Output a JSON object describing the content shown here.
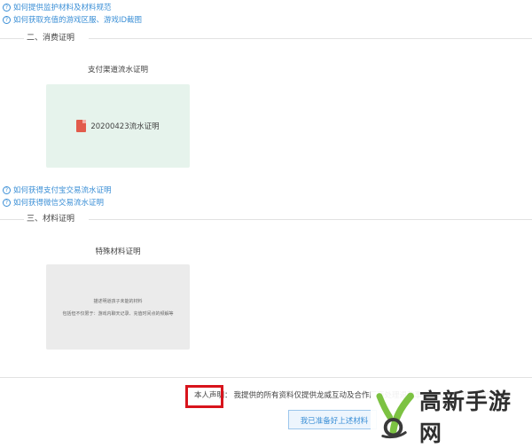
{
  "links_top": [
    {
      "text": "如何提供监护材料及材料规范"
    },
    {
      "text": "如何获取充值的游戏区服、游戏ID截图"
    }
  ],
  "section_consumption": {
    "title": "二、消费证明",
    "card_title": "支付渠道流水证明",
    "file_name": "20200423流水证明"
  },
  "links_mid": [
    {
      "text": "如何获得支付宝交易流水证明"
    },
    {
      "text": "如何获得微信交易流水证明"
    }
  ],
  "section_materials": {
    "title": "三、材料证明",
    "card_title": "特殊材料证明",
    "card_line1": "描述明道孩子未能的材料",
    "card_line2": "包括但不仅限于：游戏内聊天记录、充值时间点的频解等"
  },
  "statement": {
    "label": "本人声明：",
    "text": "我提供的所有资料仅提供龙威互动及合作厂商处理退款事宜适用，不得做其他用途"
  },
  "confirm_button": "我已准备好上述材料",
  "watermark": {
    "text": "高新手游网",
    "logo_colors": {
      "green": "#7cc242",
      "dark": "#3a3a3a"
    }
  },
  "colors": {
    "link": "#3b8fd6",
    "highlight_box": "#d8141c",
    "pay_card_bg": "#e6f3ec",
    "material_card_bg": "#ebebeb",
    "pdf_icon": "#e25b4c"
  }
}
